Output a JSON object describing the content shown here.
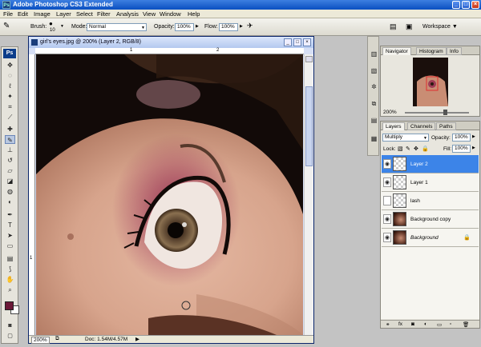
{
  "window": {
    "title": "Adobe Photoshop CS3 Extended",
    "logo": "Ps"
  },
  "menu": [
    "File",
    "Edit",
    "Image",
    "Layer",
    "Select",
    "Filter",
    "Analysis",
    "View",
    "Window",
    "Help"
  ],
  "options": {
    "brush_label": "Brush:",
    "brush_size": "10",
    "mode_label": "Mode:",
    "mode_value": "Normal",
    "opacity_label": "Opacity:",
    "opacity_value": "100%",
    "flow_label": "Flow:",
    "flow_value": "100%",
    "workspace_label": "Workspace"
  },
  "toolbox": {
    "logo": "Ps",
    "foreground_color": "#6b1838",
    "background_color": "#ffffff"
  },
  "document": {
    "title": "girl's eyes.jpg @ 200% (Layer 2, RGB/8)",
    "ruler_h": [
      "1",
      "2"
    ],
    "ruler_v": [
      "1"
    ],
    "zoom": "200%",
    "doc_size": "Doc: 1.54M/4.57M"
  },
  "navigator": {
    "tabs": [
      "Navigator",
      "Histogram",
      "Info"
    ],
    "zoom": "200%"
  },
  "layers_panel": {
    "tabs": [
      "Layers",
      "Channels",
      "Paths"
    ],
    "blend_mode": "Multiply",
    "opacity_label": "Opacity:",
    "opacity_value": "100%",
    "lock_label": "Lock:",
    "fill_label": "Fill:",
    "fill_value": "100%",
    "layers": [
      {
        "name": "Layer 2",
        "visible": true,
        "active": true
      },
      {
        "name": "Layer 1",
        "visible": true,
        "active": false
      },
      {
        "name": "lash",
        "visible": false,
        "active": false
      },
      {
        "name": "Background copy",
        "visible": true,
        "active": false
      },
      {
        "name": "Background",
        "visible": true,
        "active": false,
        "locked": true
      }
    ]
  }
}
